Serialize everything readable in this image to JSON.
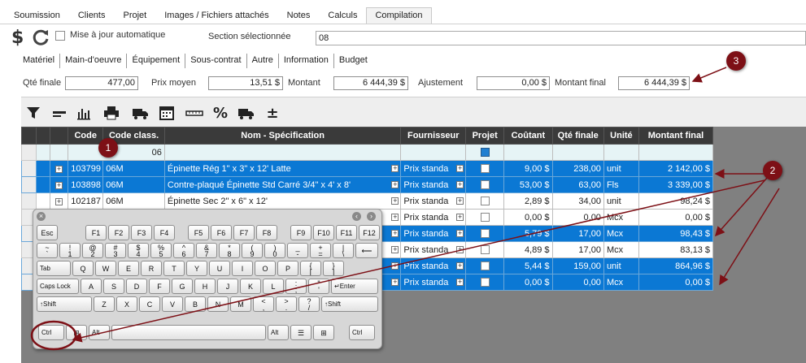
{
  "top_tabs": [
    "Soumission",
    "Clients",
    "Projet",
    "Images / Fichiers attachés",
    "Notes",
    "Calculs",
    "Compilation"
  ],
  "active_tab": "Compilation",
  "toolbar": {
    "dollar_symbol": "$",
    "auto_update_label": "Mise à jour automatique",
    "section_label": "Section sélectionnée",
    "section_value": "08"
  },
  "sub_tabs": [
    "Matériel",
    "Main-d'oeuvre",
    "Équipement",
    "Sous-contrat",
    "Autre",
    "Information",
    "Budget"
  ],
  "totals": {
    "qte_finale_label": "Qté finale",
    "qte_finale_value": "477,00",
    "prix_moyen_label": "Prix moyen",
    "prix_moyen_value": "13,51 $",
    "montant_label": "Montant",
    "montant_value": "6 444,39 $",
    "ajustement_label": "Ajustement",
    "ajustement_value": "0,00 $",
    "montant_final_label": "Montant final",
    "montant_final_value": "6 444,39 $"
  },
  "icons": [
    "filter-icon",
    "minus-line-icon",
    "chart-icon",
    "print-icon",
    "truck-add-icon",
    "calendar-icon",
    "ruler-icon",
    "percent-icon",
    "truck-icon",
    "plus-minus-icon"
  ],
  "grid": {
    "headers": [
      "Code",
      "Code class.",
      "Nom - Spécification",
      "Fournisseur",
      "Projet",
      "Coûtant",
      "Qté finale",
      "Unité",
      "Montant final"
    ],
    "group_value": "06",
    "rows": [
      {
        "code": "103799",
        "class": "06M",
        "name": "Épinette Rég   1\" x  3\" x 12' Latte",
        "supplier": "Prix standa",
        "cost": "9,00 $",
        "qty": "238,00",
        "unit": "unit",
        "amount": "2 142,00 $",
        "selected": true
      },
      {
        "code": "103898",
        "class": "06M",
        "name": "Contre-plaqué Épinette Std Carré 3/4\" x 4' x 8'",
        "supplier": "Prix standa",
        "cost": "53,00 $",
        "qty": "63,00",
        "unit": "Fls",
        "amount": "3 339,00 $",
        "selected": true
      },
      {
        "code": "102187",
        "class": "06M",
        "name": "Épinette Sec  2\" x  6\" x 12'",
        "supplier": "Prix standa",
        "cost": "2,89 $",
        "qty": "34,00",
        "unit": "unit",
        "amount": "98,24 $",
        "selected": false
      },
      {
        "code": "",
        "class": "",
        "name": "",
        "supplier": "Prix standa",
        "cost": "0,00 $",
        "qty": "0,00",
        "unit": "Mcx",
        "amount": "0,00 $",
        "selected": false
      },
      {
        "code": "",
        "class": "",
        "name": "",
        "supplier": "Prix standa",
        "cost": "5,79 $",
        "qty": "17,00",
        "unit": "Mcx",
        "amount": "98,43 $",
        "selected": true
      },
      {
        "code": "",
        "class": "",
        "name": "",
        "supplier": "Prix standa",
        "cost": "4,89 $",
        "qty": "17,00",
        "unit": "Mcx",
        "amount": "83,13 $",
        "selected": false
      },
      {
        "code": "",
        "class": "",
        "name": "",
        "supplier": "Prix standa",
        "cost": "5,44 $",
        "qty": "159,00",
        "unit": "unit",
        "amount": "864,96 $",
        "selected": true
      },
      {
        "code": "",
        "class": "",
        "name": "",
        "supplier": "Prix standa",
        "cost": "0,00 $",
        "qty": "0,00",
        "unit": "Mcx",
        "amount": "0,00 $",
        "selected": true
      }
    ]
  },
  "keyboard": {
    "row_f": [
      "Esc",
      "F1",
      "F2",
      "F3",
      "F4",
      "F5",
      "F6",
      "F7",
      "F8",
      "F9",
      "F10",
      "F11",
      "F12"
    ],
    "row_num": [
      [
        "~",
        "`"
      ],
      [
        "!",
        "1"
      ],
      [
        "@",
        "2"
      ],
      [
        "#",
        "3"
      ],
      [
        "$",
        "4"
      ],
      [
        "%",
        "5"
      ],
      [
        "^",
        "6"
      ],
      [
        "&",
        "7"
      ],
      [
        "*",
        "8"
      ],
      [
        "(",
        "9"
      ],
      [
        ")",
        "0"
      ],
      [
        "_",
        "-"
      ],
      [
        "+",
        "="
      ],
      [
        "|",
        "\\"
      ],
      [
        "⟵",
        ""
      ]
    ],
    "row_q_keys": [
      "Q",
      "W",
      "E",
      "R",
      "T",
      "Y",
      "U",
      "I",
      "O",
      "P"
    ],
    "row_q_punct": [
      [
        "{",
        "["
      ],
      [
        "}",
        "]"
      ]
    ],
    "row_a_keys": [
      "A",
      "S",
      "D",
      "F",
      "G",
      "H",
      "J",
      "K",
      "L"
    ],
    "row_a_punct": [
      [
        ":",
        ";"
      ],
      [
        "\"",
        "'"
      ]
    ],
    "row_z_keys": [
      "Z",
      "X",
      "C",
      "V",
      "B",
      "N",
      "M"
    ],
    "row_z_punct": [
      [
        "<",
        ","
      ],
      [
        ">",
        "."
      ],
      [
        "?",
        "/"
      ]
    ],
    "tab": "Tab",
    "caps": "Caps Lock",
    "enter": "↵Enter",
    "lshift": "↑Shift",
    "rshift": "↑Shift",
    "ctrl": "Ctrl",
    "alt": "Alt",
    "alt2": "Alt",
    "rctrl": "Ctrl"
  },
  "annotations": [
    "1",
    "2",
    "3"
  ],
  "colors": {
    "selection": "#0b78d4",
    "header": "#3a3a3a",
    "annotation": "#7d1016"
  }
}
